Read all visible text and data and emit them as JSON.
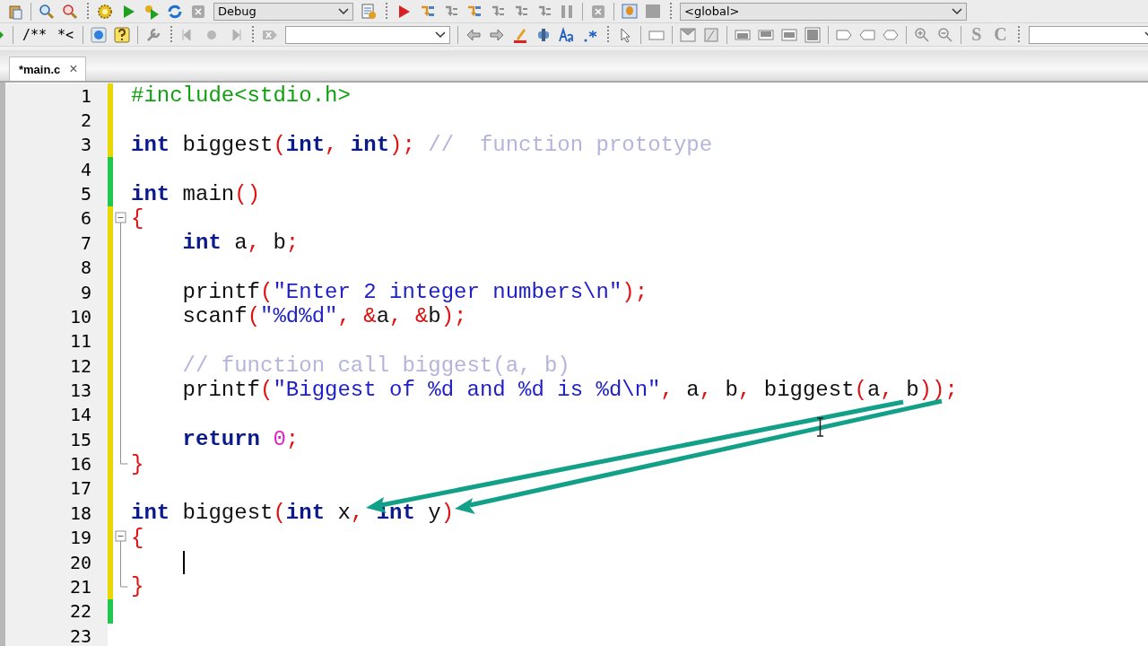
{
  "toolbar": {
    "build_target": "Debug",
    "scope": "<global>",
    "doc_buttons": [
      "/**",
      "*<"
    ],
    "letter_tools": [
      "S",
      "C"
    ]
  },
  "tabs": [
    {
      "label": "*main.c",
      "selected": true,
      "close": "×"
    }
  ],
  "editor": {
    "lines": [
      {
        "number": "1",
        "color": "#e8d800",
        "tokens": [
          {
            "kind": "pre",
            "text": "#include<stdio.h>"
          }
        ]
      },
      {
        "number": "2",
        "color": "#e8d800"
      },
      {
        "number": "3",
        "color": "#e8d800",
        "tokens": [
          {
            "kind": "kw",
            "text": "int"
          },
          {
            "kind": "id",
            "text": " biggest"
          },
          {
            "kind": "p",
            "text": "("
          },
          {
            "kind": "kw",
            "text": "int"
          },
          {
            "kind": "p",
            "text": ","
          },
          {
            "kind": "kw",
            "text": " int"
          },
          {
            "kind": "p",
            "text": ");"
          },
          {
            "kind": "cm",
            "text": " //  function prototype"
          }
        ]
      },
      {
        "number": "4",
        "color": "#20c850"
      },
      {
        "number": "5",
        "color": "#20c850",
        "tokens": [
          {
            "kind": "kw",
            "text": "int"
          },
          {
            "kind": "id",
            "text": " main"
          },
          {
            "kind": "p",
            "text": "()"
          }
        ]
      },
      {
        "number": "6",
        "color": "#e8d800",
        "fold": {
          "kind": "open"
        },
        "tokens": [
          {
            "kind": "p",
            "text": "{"
          }
        ]
      },
      {
        "number": "7",
        "color": "#e8d800",
        "fold": {
          "kind": "inside"
        },
        "tokens": [
          {
            "kind": "kw",
            "text": "    int"
          },
          {
            "kind": "id",
            "text": " a"
          },
          {
            "kind": "p",
            "text": ","
          },
          {
            "kind": "id",
            "text": " b"
          },
          {
            "kind": "p",
            "text": ";"
          }
        ]
      },
      {
        "number": "8",
        "color": "#e8d800",
        "fold": {
          "kind": "inside"
        }
      },
      {
        "number": "9",
        "color": "#e8d800",
        "fold": {
          "kind": "inside"
        },
        "tokens": [
          {
            "kind": "id",
            "text": "    printf"
          },
          {
            "kind": "p",
            "text": "("
          },
          {
            "kind": "str",
            "text": "\"Enter 2 integer numbers\\n\""
          },
          {
            "kind": "p",
            "text": ");"
          }
        ]
      },
      {
        "number": "10",
        "color": "#e8d800",
        "fold": {
          "kind": "inside"
        },
        "tokens": [
          {
            "kind": "id",
            "text": "    scanf"
          },
          {
            "kind": "p",
            "text": "("
          },
          {
            "kind": "str",
            "text": "\"%d%d\""
          },
          {
            "kind": "p",
            "text": ", &"
          },
          {
            "kind": "id",
            "text": "a"
          },
          {
            "kind": "p",
            "text": ", &"
          },
          {
            "kind": "id",
            "text": "b"
          },
          {
            "kind": "p",
            "text": ");"
          }
        ]
      },
      {
        "number": "11",
        "color": "#e8d800",
        "fold": {
          "kind": "inside"
        }
      },
      {
        "number": "12",
        "color": "#e8d800",
        "fold": {
          "kind": "inside"
        },
        "tokens": [
          {
            "kind": "cm",
            "text": "    // function call biggest(a, b)"
          }
        ]
      },
      {
        "number": "13",
        "color": "#e8d800",
        "fold": {
          "kind": "inside"
        },
        "tokens": [
          {
            "kind": "id",
            "text": "    printf"
          },
          {
            "kind": "p",
            "text": "("
          },
          {
            "kind": "str",
            "text": "\"Biggest of %d and %d is %d\\n\""
          },
          {
            "kind": "p",
            "text": ","
          },
          {
            "kind": "id",
            "text": " a"
          },
          {
            "kind": "p",
            "text": ","
          },
          {
            "kind": "id",
            "text": " b"
          },
          {
            "kind": "p",
            "text": ","
          },
          {
            "kind": "id",
            "text": " biggest"
          },
          {
            "kind": "p",
            "text": "("
          },
          {
            "kind": "id",
            "text": "a"
          },
          {
            "kind": "p",
            "text": ","
          },
          {
            "kind": "id",
            "text": " b"
          },
          {
            "kind": "p",
            "text": "));"
          }
        ]
      },
      {
        "number": "14",
        "color": "#e8d800",
        "fold": {
          "kind": "inside"
        }
      },
      {
        "number": "15",
        "color": "#e8d800",
        "fold": {
          "kind": "inside"
        },
        "tokens": [
          {
            "kind": "kw",
            "text": "    return"
          },
          {
            "kind": "num",
            "text": " 0"
          },
          {
            "kind": "p",
            "text": ";"
          }
        ]
      },
      {
        "number": "16",
        "color": "#e8d800",
        "fold": {
          "kind": "end"
        },
        "tokens": [
          {
            "kind": "p",
            "text": "}"
          }
        ]
      },
      {
        "number": "17",
        "color": "#e8d800"
      },
      {
        "number": "18",
        "color": "#e8d800",
        "tokens": [
          {
            "kind": "kw",
            "text": "int"
          },
          {
            "kind": "id",
            "text": " biggest"
          },
          {
            "kind": "p",
            "text": "("
          },
          {
            "kind": "kw",
            "text": "int"
          },
          {
            "kind": "id",
            "text": " x"
          },
          {
            "kind": "p",
            "text": ","
          },
          {
            "kind": "kw",
            "text": " int"
          },
          {
            "kind": "id",
            "text": " y"
          },
          {
            "kind": "p",
            "text": ")"
          }
        ]
      },
      {
        "number": "19",
        "color": "#e8d800",
        "fold": {
          "kind": "open"
        },
        "tokens": [
          {
            "kind": "p",
            "text": "{"
          }
        ]
      },
      {
        "number": "20",
        "color": "#e8d800",
        "fold": {
          "kind": "inside"
        },
        "cursor": true
      },
      {
        "number": "21",
        "color": "#e8d800",
        "fold": {
          "kind": "end"
        },
        "tokens": [
          {
            "kind": "p",
            "text": "}"
          }
        ]
      },
      {
        "number": "22",
        "color": "#20c850"
      },
      {
        "number": "23"
      }
    ]
  }
}
